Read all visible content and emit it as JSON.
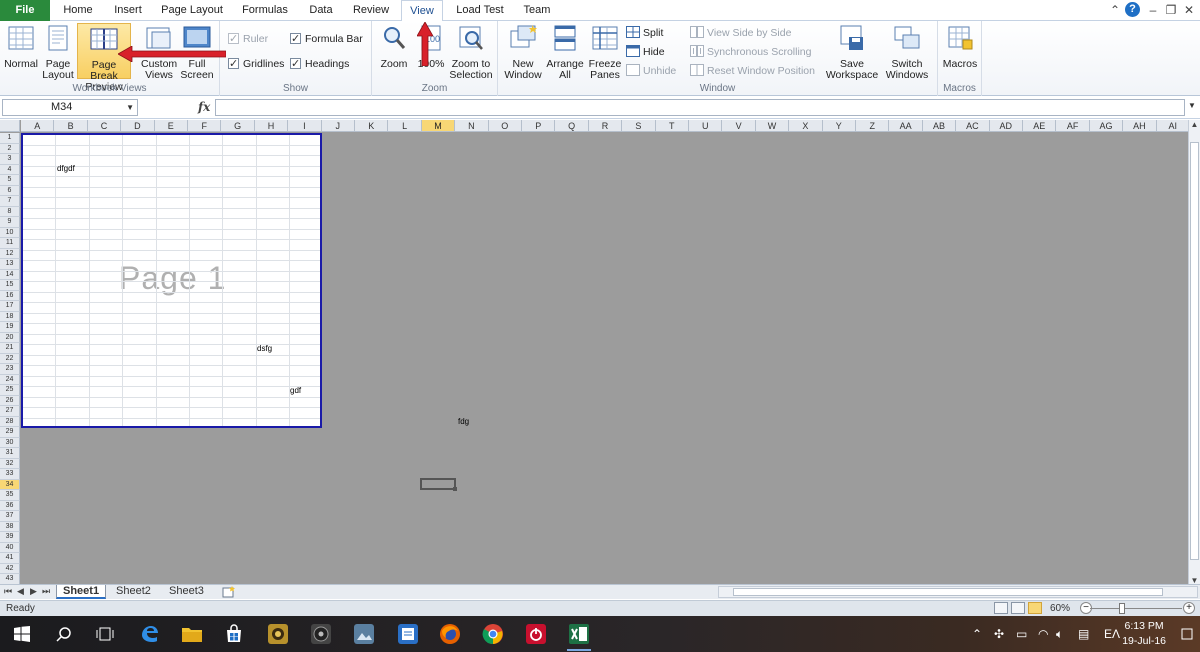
{
  "tabs": {
    "file": "File",
    "home": "Home",
    "insert": "Insert",
    "page_layout": "Page Layout",
    "formulas": "Formulas",
    "data": "Data",
    "review": "Review",
    "view": "View",
    "load_test": "Load Test",
    "team": "Team"
  },
  "ribbon": {
    "workbook_views": {
      "label": "Workbook Views",
      "normal": "Normal",
      "page_layout": "Page Layout",
      "page_break_preview": "Page Break Preview",
      "custom_views": "Custom Views",
      "full_screen": "Full Screen"
    },
    "show": {
      "label": "Show",
      "ruler": "Ruler",
      "formula_bar": "Formula Bar",
      "gridlines": "Gridlines",
      "headings": "Headings",
      "ruler_checked": true,
      "formula_bar_checked": true,
      "gridlines_checked": true,
      "headings_checked": true
    },
    "zoom": {
      "label": "Zoom",
      "zoom": "Zoom",
      "hundred": "100%",
      "zoom_to_selection": "Zoom to Selection"
    },
    "window": {
      "label": "Window",
      "new_window": "New Window",
      "arrange_all": "Arrange All",
      "freeze_panes": "Freeze Panes",
      "split": "Split",
      "hide": "Hide",
      "unhide": "Unhide",
      "view_side_by_side": "View Side by Side",
      "synchronous_scrolling": "Synchronous Scrolling",
      "reset_window_position": "Reset Window Position",
      "save_workspace": "Save Workspace",
      "switch_windows": "Switch Windows"
    },
    "macros": {
      "label": "Macros",
      "macros": "Macros"
    }
  },
  "formula_bar": {
    "name_box": "M34",
    "fx": "fx",
    "value": ""
  },
  "columns": [
    "A",
    "B",
    "C",
    "D",
    "E",
    "F",
    "G",
    "H",
    "I",
    "J",
    "K",
    "L",
    "M",
    "N",
    "O",
    "P",
    "Q",
    "R",
    "S",
    "T",
    "U",
    "V",
    "W",
    "X",
    "Y",
    "Z",
    "AA",
    "AB",
    "AC",
    "AD",
    "AE",
    "AF",
    "AG",
    "AH",
    "AI"
  ],
  "selected_column": "M",
  "rows": [
    "1",
    "2",
    "3",
    "4",
    "5",
    "6",
    "7",
    "8",
    "9",
    "10",
    "11",
    "12",
    "13",
    "14",
    "15",
    "16",
    "17",
    "18",
    "19",
    "20",
    "21",
    "22",
    "23",
    "24",
    "25",
    "26",
    "27",
    "28",
    "29",
    "30",
    "31",
    "32",
    "33",
    "34",
    "35",
    "36",
    "37",
    "38",
    "39",
    "40",
    "41",
    "42",
    "43"
  ],
  "selected_row": "34",
  "page_label": "Page 1",
  "cells": {
    "b4": "dfgdf",
    "h21": "dsfg",
    "i25": "gdf",
    "n28": "fdg"
  },
  "sheets": [
    "Sheet1",
    "Sheet2",
    "Sheet3"
  ],
  "active_sheet": "Sheet1",
  "status": {
    "ready": "Ready",
    "zoom": "60%",
    "zoom_minus": "−",
    "zoom_plus": "+"
  },
  "taskbar": {
    "time": "6:13 PM",
    "date": "19-Jul-16",
    "lang": "EΛ"
  },
  "colors": {
    "accent_file": "#2a8a3c",
    "page_border": "#1a1aa8",
    "selected_header": "#f8d775",
    "annotation_arrow": "#d8202a"
  }
}
